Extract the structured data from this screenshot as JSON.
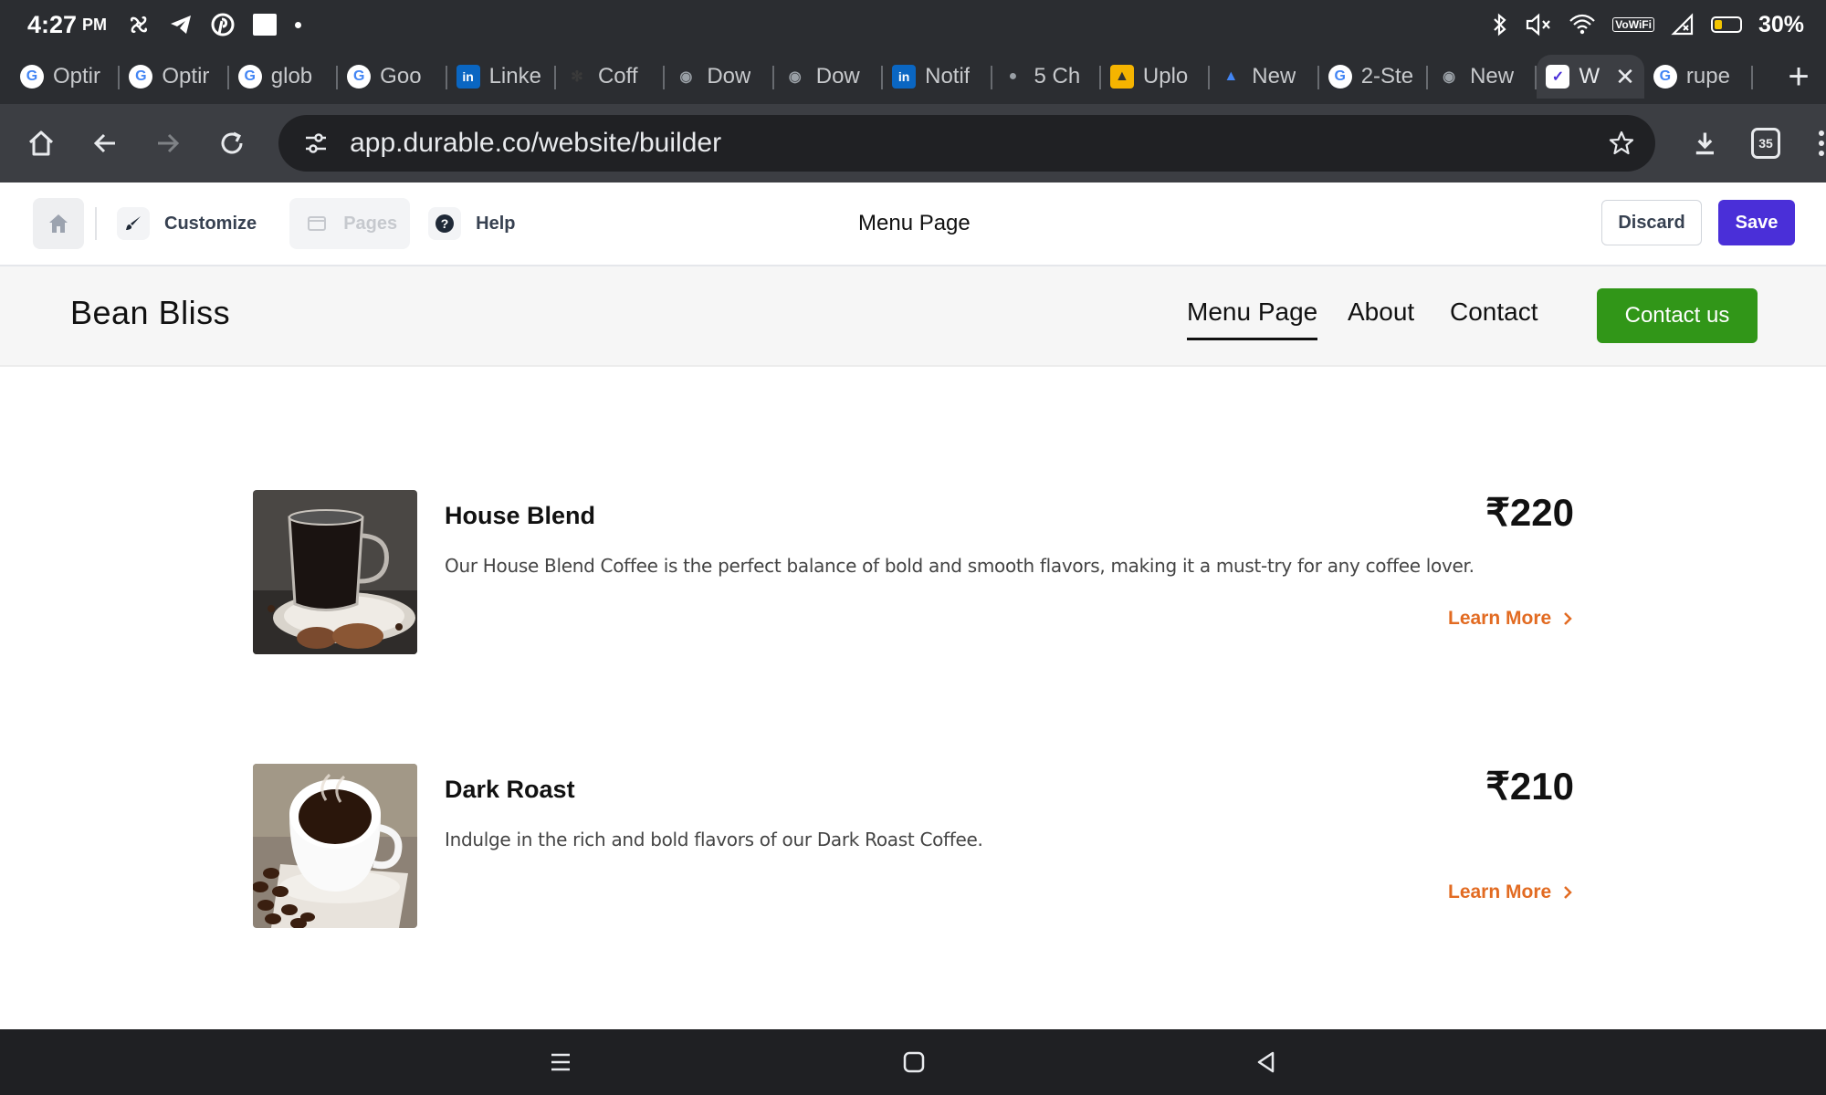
{
  "status_bar": {
    "time": "4:27",
    "ampm": "PM",
    "battery_text": "30%",
    "battery_level": 0.3,
    "vowifi": "VoWiFi",
    "icons": [
      "fan-icon",
      "telegram-icon",
      "pinterest-icon",
      "app-icon",
      "dot-icon",
      "bluetooth-icon",
      "mute-icon",
      "wifi-icon",
      "signal-icon"
    ]
  },
  "tabs": [
    {
      "label": "Optir",
      "icon": "google-icon",
      "color": "#4285f4"
    },
    {
      "label": "Optir",
      "icon": "google-icon",
      "color": "#4285f4"
    },
    {
      "label": "glob",
      "icon": "google-icon",
      "color": "#4285f4"
    },
    {
      "label": "Goo",
      "icon": "google-icon",
      "color": "#4285f4"
    },
    {
      "label": "Linke",
      "icon": "linkedin-icon",
      "color": "#0a66c2"
    },
    {
      "label": "Coff",
      "icon": "leaf-icon",
      "color": "#3a3a3a"
    },
    {
      "label": "Dow",
      "icon": "chrome-icon",
      "color": "#9aa0a6"
    },
    {
      "label": "Dow",
      "icon": "chrome-icon",
      "color": "#9aa0a6"
    },
    {
      "label": "Notif",
      "icon": "linkedin-icon",
      "color": "#0a66c2"
    },
    {
      "label": "5 Ch",
      "icon": "globe-icon",
      "color": "#9aa0a6"
    },
    {
      "label": "Uplo",
      "icon": "upload-icon",
      "color": "#f5b400"
    },
    {
      "label": "New",
      "icon": "google-ads-icon",
      "color": "#4285f4"
    },
    {
      "label": "2-Ste",
      "icon": "google-icon",
      "color": "#4285f4"
    },
    {
      "label": "New",
      "icon": "chrome-icon",
      "color": "#9aa0a6"
    },
    {
      "label": "W",
      "icon": "durable-icon",
      "color": "#ffffff",
      "active": true
    },
    {
      "label": "rupe",
      "icon": "google-icon",
      "color": "#4285f4"
    }
  ],
  "browser": {
    "url": "app.durable.co/website/builder",
    "tab_count": "35"
  },
  "builder": {
    "customize_label": "Customize",
    "pages_label": "Pages",
    "help_label": "Help",
    "page_title": "Menu Page",
    "discard_label": "Discard",
    "save_label": "Save",
    "save_color": "#4a2fd8"
  },
  "site": {
    "brand": "Bean Bliss",
    "nav": {
      "menu_page": "Menu Page",
      "about": "About",
      "contact": "Contact",
      "cta": "Contact us"
    },
    "cta_color": "#319618",
    "accent_color": "#e26b22",
    "items": [
      {
        "title": "House Blend",
        "description": "Our House Blend Coffee is the perfect balance of bold and smooth flavors, making it a must-try for any coffee lover.",
        "price": "₹220",
        "link": "Learn More"
      },
      {
        "title": "Dark Roast",
        "description": "Indulge in the rich and bold flavors of our Dark Roast Coffee.",
        "price": "₹210",
        "link": "Learn More"
      }
    ]
  }
}
